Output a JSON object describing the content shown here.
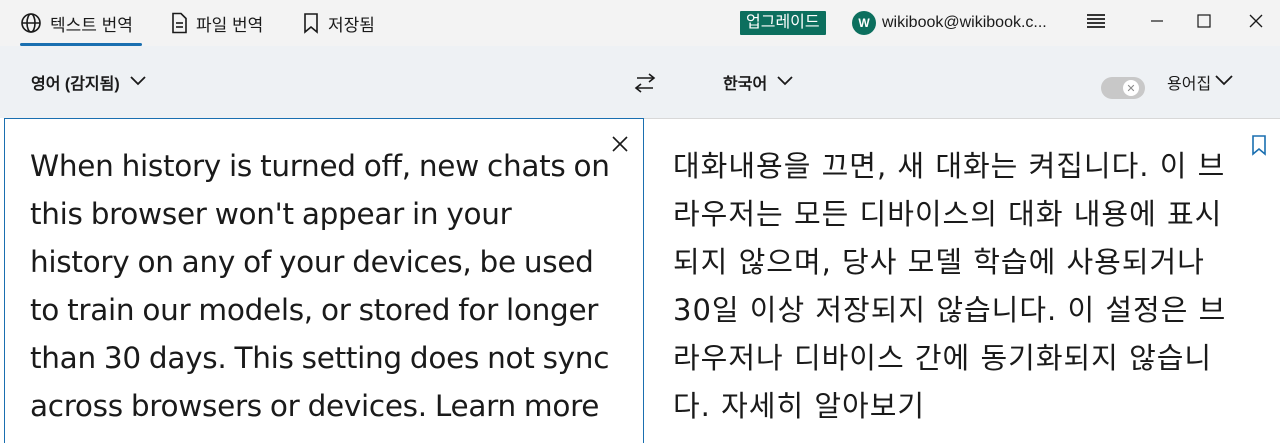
{
  "tabs": [
    {
      "label": "텍스트 번역",
      "icon": "globe-icon",
      "active": true
    },
    {
      "label": "파일 번역",
      "icon": "file-icon",
      "active": false
    },
    {
      "label": "저장됨",
      "icon": "bookmark-icon",
      "active": false
    }
  ],
  "header": {
    "upgrade_label": "업그레이드",
    "avatar_initial": "W",
    "account_email": "wikibook@wikibook.c..."
  },
  "language_bar": {
    "source_language": "영어 (감지됨)",
    "target_language": "한국어",
    "glossary_label": "용어집",
    "glossary_enabled": false
  },
  "source": {
    "text": "When history is turned off, new chats on this browser won't appear in your history on any of your devices, be used to train our models, or stored for longer than 30 days. This setting does not sync across browsers or devices. Learn more"
  },
  "target": {
    "text": "대화내용을 끄면, 새 대화는 켜집니다. 이 브라우저는 모든 디바이스의 대화 내용에 표시되지 않으며, 당사 모델 학습에 사용되거나 30일 이상 저장되지 않습니다. 이 설정은 브라우저나 디바이스 간에 동기화되지 않습니다. 자세히 알아보기"
  },
  "colors": {
    "accent": "#1a6fb0",
    "upgrade": "#0c6f5e",
    "topbar_bg": "#f3f3f3",
    "langbar_bg": "#eef1f4"
  }
}
